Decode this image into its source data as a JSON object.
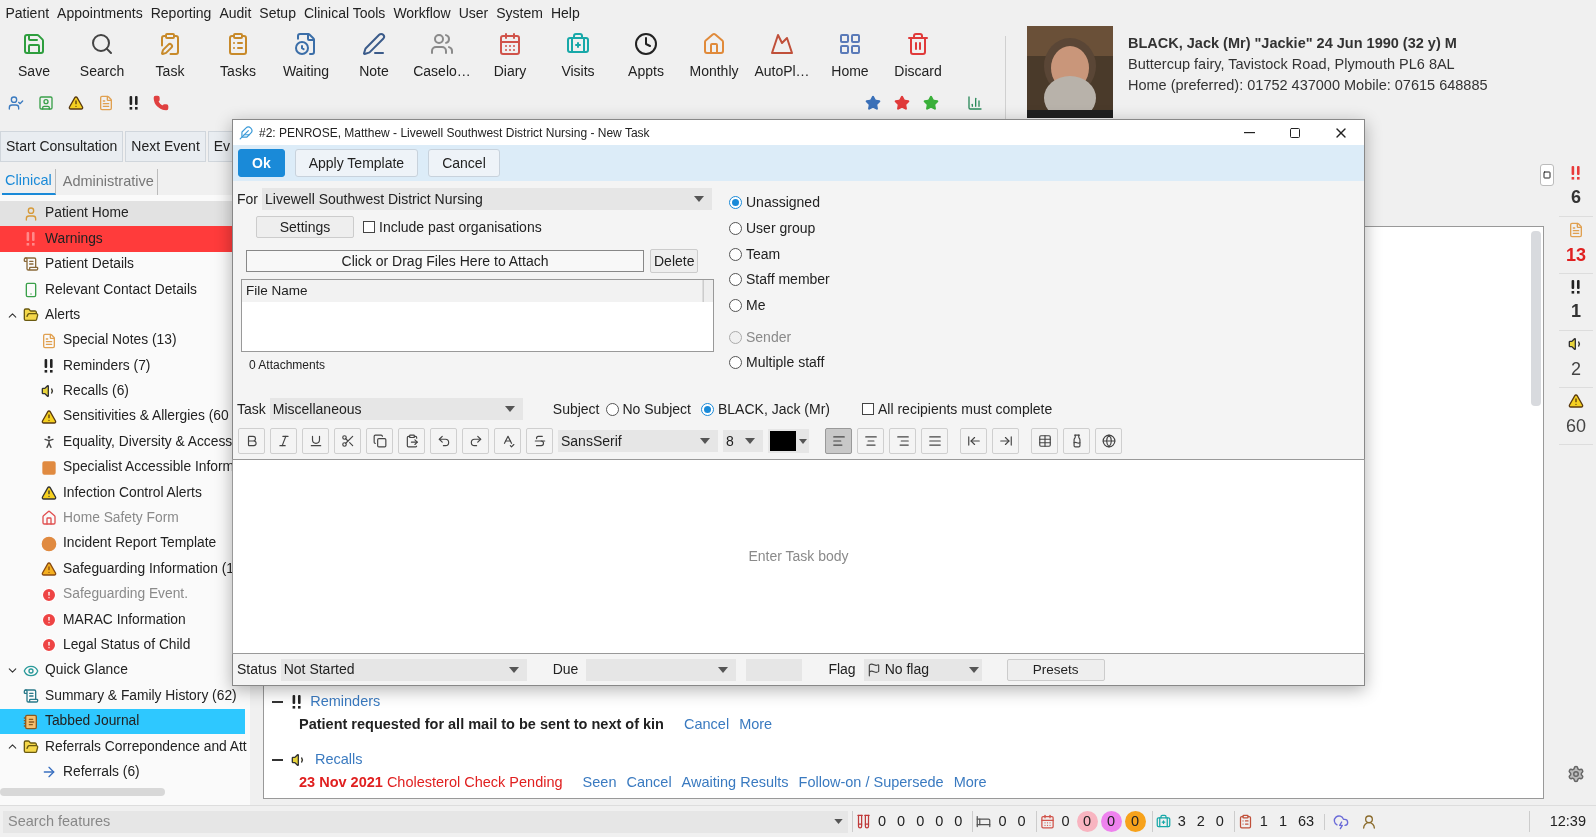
{
  "menu": [
    "Patient",
    "Appointments",
    "Reporting",
    "Audit",
    "Setup",
    "Clinical Tools",
    "Workflow",
    "User",
    "System",
    "Help"
  ],
  "toolbar": [
    "Save",
    "Search",
    "Task",
    "Tasks",
    "Waiting",
    "Note",
    "Caselo…",
    "Diary",
    "Visits",
    "Appts",
    "Monthly",
    "AutoPl…",
    "Home",
    "Discard"
  ],
  "patient": {
    "name_line": "BLACK, Jack (Mr) \"Jackie\" 24 Jun 1990 (32 y) M",
    "address": "Buttercup fairy, Tavistock Road, Plymouth PL6 8AL",
    "phone": "Home (preferred): 01752 437000 Mobile: 07615 648885"
  },
  "actions": [
    "Start Consultation",
    "Next Event",
    "Ev"
  ],
  "view_tabs": [
    {
      "label": "Clinical",
      "selected": true
    },
    {
      "label": "Administrative",
      "selected": false
    }
  ],
  "sidebar": [
    {
      "label": "Patient Home",
      "selected": false,
      "hovered": true
    },
    {
      "label": "Warnings",
      "selected": false,
      "warning": true
    },
    {
      "label": "Patient Details",
      "selected": false
    },
    {
      "label": "Relevant Contact Details",
      "selected": false
    },
    {
      "label": "Alerts",
      "selected": false,
      "expanded": true,
      "children": [
        {
          "label": "Special Notes (13)",
          "selected": false
        },
        {
          "label": "Reminders (7)",
          "selected": false
        },
        {
          "label": "Recalls (6)",
          "selected": false
        },
        {
          "label": "Sensitivities & Allergies (60",
          "selected": false
        },
        {
          "label": "Equality, Diversity & Access",
          "selected": false
        },
        {
          "label": "Specialist Accessible Inform",
          "selected": false
        },
        {
          "label": "Infection Control Alerts",
          "selected": false
        },
        {
          "label": "Home Safety Form",
          "selected": false,
          "disabled": true
        },
        {
          "label": "Incident Report Template",
          "selected": false
        },
        {
          "label": "Safeguarding Information (1",
          "selected": false
        },
        {
          "label": "Safeguarding Event.",
          "selected": false,
          "disabled": true
        },
        {
          "label": "MARAC Information",
          "selected": false
        },
        {
          "label": "Legal Status of Child",
          "selected": false
        }
      ]
    },
    {
      "label": "Quick Glance",
      "selected": false,
      "expanded": false
    },
    {
      "label": "Summary & Family History (62)",
      "selected": false
    },
    {
      "label": "Tabbed Journal",
      "selected": true
    },
    {
      "label": "Referrals Correpondence and Att",
      "selected": false,
      "expanded": true,
      "children": [
        {
          "label": "Referrals (6)",
          "selected": false
        }
      ]
    }
  ],
  "journal": [
    {
      "title": "Reminders",
      "expanded": true,
      "entries": [
        {
          "kind": "note",
          "text": "Patient requested for all mail to be sent to next of kin",
          "links": [
            "Cancel",
            "More"
          ]
        }
      ]
    },
    {
      "title": "Recalls",
      "expanded": true,
      "entries": [
        {
          "kind": "recall",
          "date": "23 Nov 2021",
          "text": "Cholesterol Check Pending",
          "links": [
            "Seen",
            "Cancel",
            "Awaiting Results",
            "Follow-on / Supersede",
            "More"
          ]
        }
      ]
    }
  ],
  "right_rail": [
    {
      "kind": "warning",
      "count": "6"
    },
    {
      "kind": "note",
      "count": "13"
    },
    {
      "kind": "reminder",
      "count": "1"
    },
    {
      "kind": "recall",
      "count": "2"
    },
    {
      "kind": "allergy",
      "count": "60"
    }
  ],
  "dialog": {
    "title": "#2: PENROSE, Matthew - Livewell Southwest District Nursing - New Task",
    "buttons": [
      {
        "label": "Ok",
        "primary": true
      },
      {
        "label": "Apply Template",
        "primary": false
      },
      {
        "label": "Cancel",
        "primary": false
      }
    ],
    "for": {
      "label": "For",
      "value": "Livewell Southwest District Nursing"
    },
    "settings_button": "Settings",
    "include_past": {
      "label": "Include past organisations",
      "checked": false
    },
    "attach_button": "Click or Drag Files Here to Attach",
    "delete_button": "Delete",
    "files": {
      "columns": [
        "File Name"
      ],
      "footer": "0 Attachments"
    },
    "assign_to": [
      {
        "label": "Unassigned",
        "selected": true,
        "disabled": false
      },
      {
        "label": "User group",
        "selected": false,
        "disabled": false
      },
      {
        "label": "Team",
        "selected": false,
        "disabled": false
      },
      {
        "label": "Staff member",
        "selected": false,
        "disabled": false
      },
      {
        "label": "Me",
        "selected": false,
        "disabled": false
      },
      {
        "label": "Sender",
        "selected": false,
        "disabled": true
      },
      {
        "label": "Multiple staff",
        "selected": false,
        "disabled": false
      }
    ],
    "task": {
      "label": "Task",
      "value": "Miscellaneous"
    },
    "subject": {
      "label": "Subject",
      "options": [
        {
          "label": "No Subject",
          "selected": false
        },
        {
          "label": "BLACK, Jack (Mr)",
          "selected": true
        }
      ]
    },
    "all_must_complete": {
      "label": "All recipients must complete",
      "checked": false
    },
    "editor": {
      "font": "SansSerif",
      "size": "8",
      "color": "#000000",
      "alignment": [
        {
          "selected": true
        },
        {
          "selected": false
        },
        {
          "selected": false
        },
        {
          "selected": false
        }
      ],
      "placeholder": "Enter Task body"
    },
    "status": {
      "label": "Status",
      "value": "Not Started"
    },
    "due": {
      "label": "Due"
    },
    "flag": {
      "label": "Flag",
      "value": "No flag"
    },
    "presets_button": "Presets"
  },
  "status_bar": {
    "search_placeholder": "Search features",
    "groups": [
      {
        "values": [
          {
            "text": "0"
          },
          {
            "text": "0"
          },
          {
            "text": "0"
          },
          {
            "text": "0"
          },
          {
            "text": "0"
          }
        ]
      },
      {
        "values": [
          {
            "text": "0"
          },
          {
            "text": "0"
          }
        ]
      },
      {
        "values": [
          {
            "text": "0"
          },
          {
            "text": "0",
            "color": "#f8b4c0"
          },
          {
            "text": "0",
            "color": "#ee82ee"
          },
          {
            "text": "0",
            "color": "#f7a21b"
          }
        ]
      },
      {
        "values": [
          {
            "text": "3"
          },
          {
            "text": "2"
          },
          {
            "text": "0"
          }
        ]
      },
      {
        "values": [
          {
            "text": "1"
          },
          {
            "text": "1"
          },
          {
            "text": "63"
          }
        ]
      }
    ],
    "time": "12:39"
  }
}
